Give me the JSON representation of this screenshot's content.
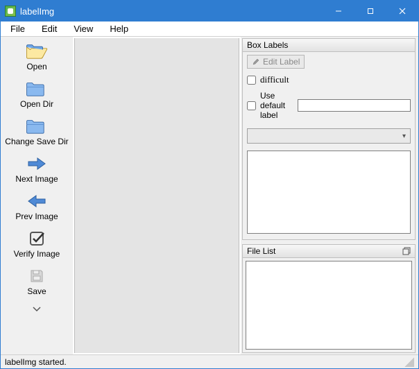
{
  "window": {
    "title": "labelImg"
  },
  "menu": {
    "file": "File",
    "edit": "Edit",
    "view": "View",
    "help": "Help"
  },
  "toolbar": {
    "open": "Open",
    "open_dir": "Open Dir",
    "change_save_dir": "Change Save Dir",
    "next_image": "Next Image",
    "prev_image": "Prev Image",
    "verify_image": "Verify Image",
    "save": "Save"
  },
  "box_labels": {
    "header": "Box Labels",
    "edit_label_btn": "Edit Label",
    "difficult_label": "difficult",
    "difficult_checked": false,
    "use_default_label": "Use default label",
    "use_default_checked": false,
    "default_label_value": "",
    "combo_selected": ""
  },
  "file_list": {
    "header": "File List"
  },
  "status": {
    "message": "labelImg started."
  }
}
